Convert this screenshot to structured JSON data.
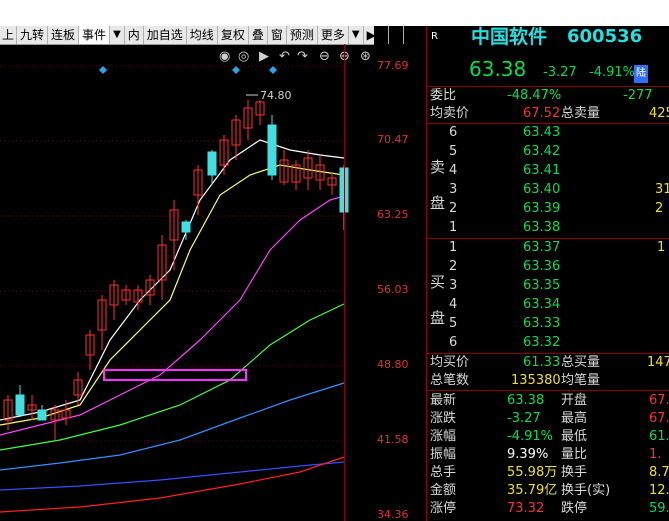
{
  "toolbar": {
    "items": [
      "九转",
      "连板",
      "事件",
      "内",
      "加自选",
      "均线",
      "复权",
      "叠",
      "窗",
      "预测",
      "更多"
    ],
    "dropdown_after": [
      false,
      false,
      true,
      false,
      false,
      false,
      false,
      false,
      false,
      false,
      true
    ]
  },
  "stock": {
    "r_label": "R",
    "name": "中国软件",
    "code": "600536",
    "price": "63.38",
    "change": "-3.27",
    "change_pct": "-4.91%",
    "exchange_badge": "陆"
  },
  "axis_labels": [
    "77.69",
    "70.47",
    "63.25",
    "56.03",
    "48.80",
    "41.58",
    "34.36"
  ],
  "high_marker": "74.80",
  "quote_summary": [
    {
      "label": "委比",
      "value": "-48.47%",
      "extra": "-277"
    },
    {
      "label": "均卖价",
      "value": "67.52",
      "label2": "总卖量",
      "extra": "425"
    }
  ],
  "sell_side_label": [
    "卖",
    "盘"
  ],
  "buy_side_label": [
    "买",
    "盘"
  ],
  "sell_orders": [
    {
      "level": "6",
      "price": "63.43",
      "qty": ""
    },
    {
      "level": "5",
      "price": "63.42",
      "qty": ""
    },
    {
      "level": "4",
      "price": "63.41",
      "qty": ""
    },
    {
      "level": "3",
      "price": "63.40",
      "qty": "31"
    },
    {
      "level": "2",
      "price": "63.39",
      "qty": "2"
    },
    {
      "level": "1",
      "price": "63.38",
      "qty": ""
    }
  ],
  "buy_orders": [
    {
      "level": "1",
      "price": "63.37",
      "qty": "1"
    },
    {
      "level": "2",
      "price": "63.36",
      "qty": ""
    },
    {
      "level": "3",
      "price": "63.35",
      "qty": ""
    },
    {
      "level": "4",
      "price": "63.34",
      "qty": ""
    },
    {
      "level": "5",
      "price": "63.33",
      "qty": ""
    },
    {
      "level": "6",
      "price": "63.32",
      "qty": ""
    }
  ],
  "buy_summary": [
    {
      "label": "均买价",
      "value": "61.33",
      "label2": "总买量",
      "extra": "147"
    },
    {
      "label": "总笔数",
      "value": "135380",
      "label2": "均笔量",
      "extra": ""
    }
  ],
  "stats": [
    {
      "l1": "最新",
      "v1": "63.38",
      "l2": "开盘",
      "v2": "67."
    },
    {
      "l1": "涨跌",
      "v1": "-3.27",
      "l2": "最高",
      "v2": "67."
    },
    {
      "l1": "涨幅",
      "v1": "-4.91%",
      "l2": "最低",
      "v2": "61."
    },
    {
      "l1": "振幅",
      "v1": "9.39%",
      "l2": "量比",
      "v2": "1."
    },
    {
      "l1": "总手",
      "v1": "55.98万",
      "l2": "换手",
      "v2": "8.7"
    },
    {
      "l1": "金额",
      "v1": "35.79亿",
      "l2": "换手(实)",
      "v2": "12.4"
    },
    {
      "l1": "涨停",
      "v1": "73.32",
      "l2": "跌停",
      "v2": "59."
    }
  ]
}
